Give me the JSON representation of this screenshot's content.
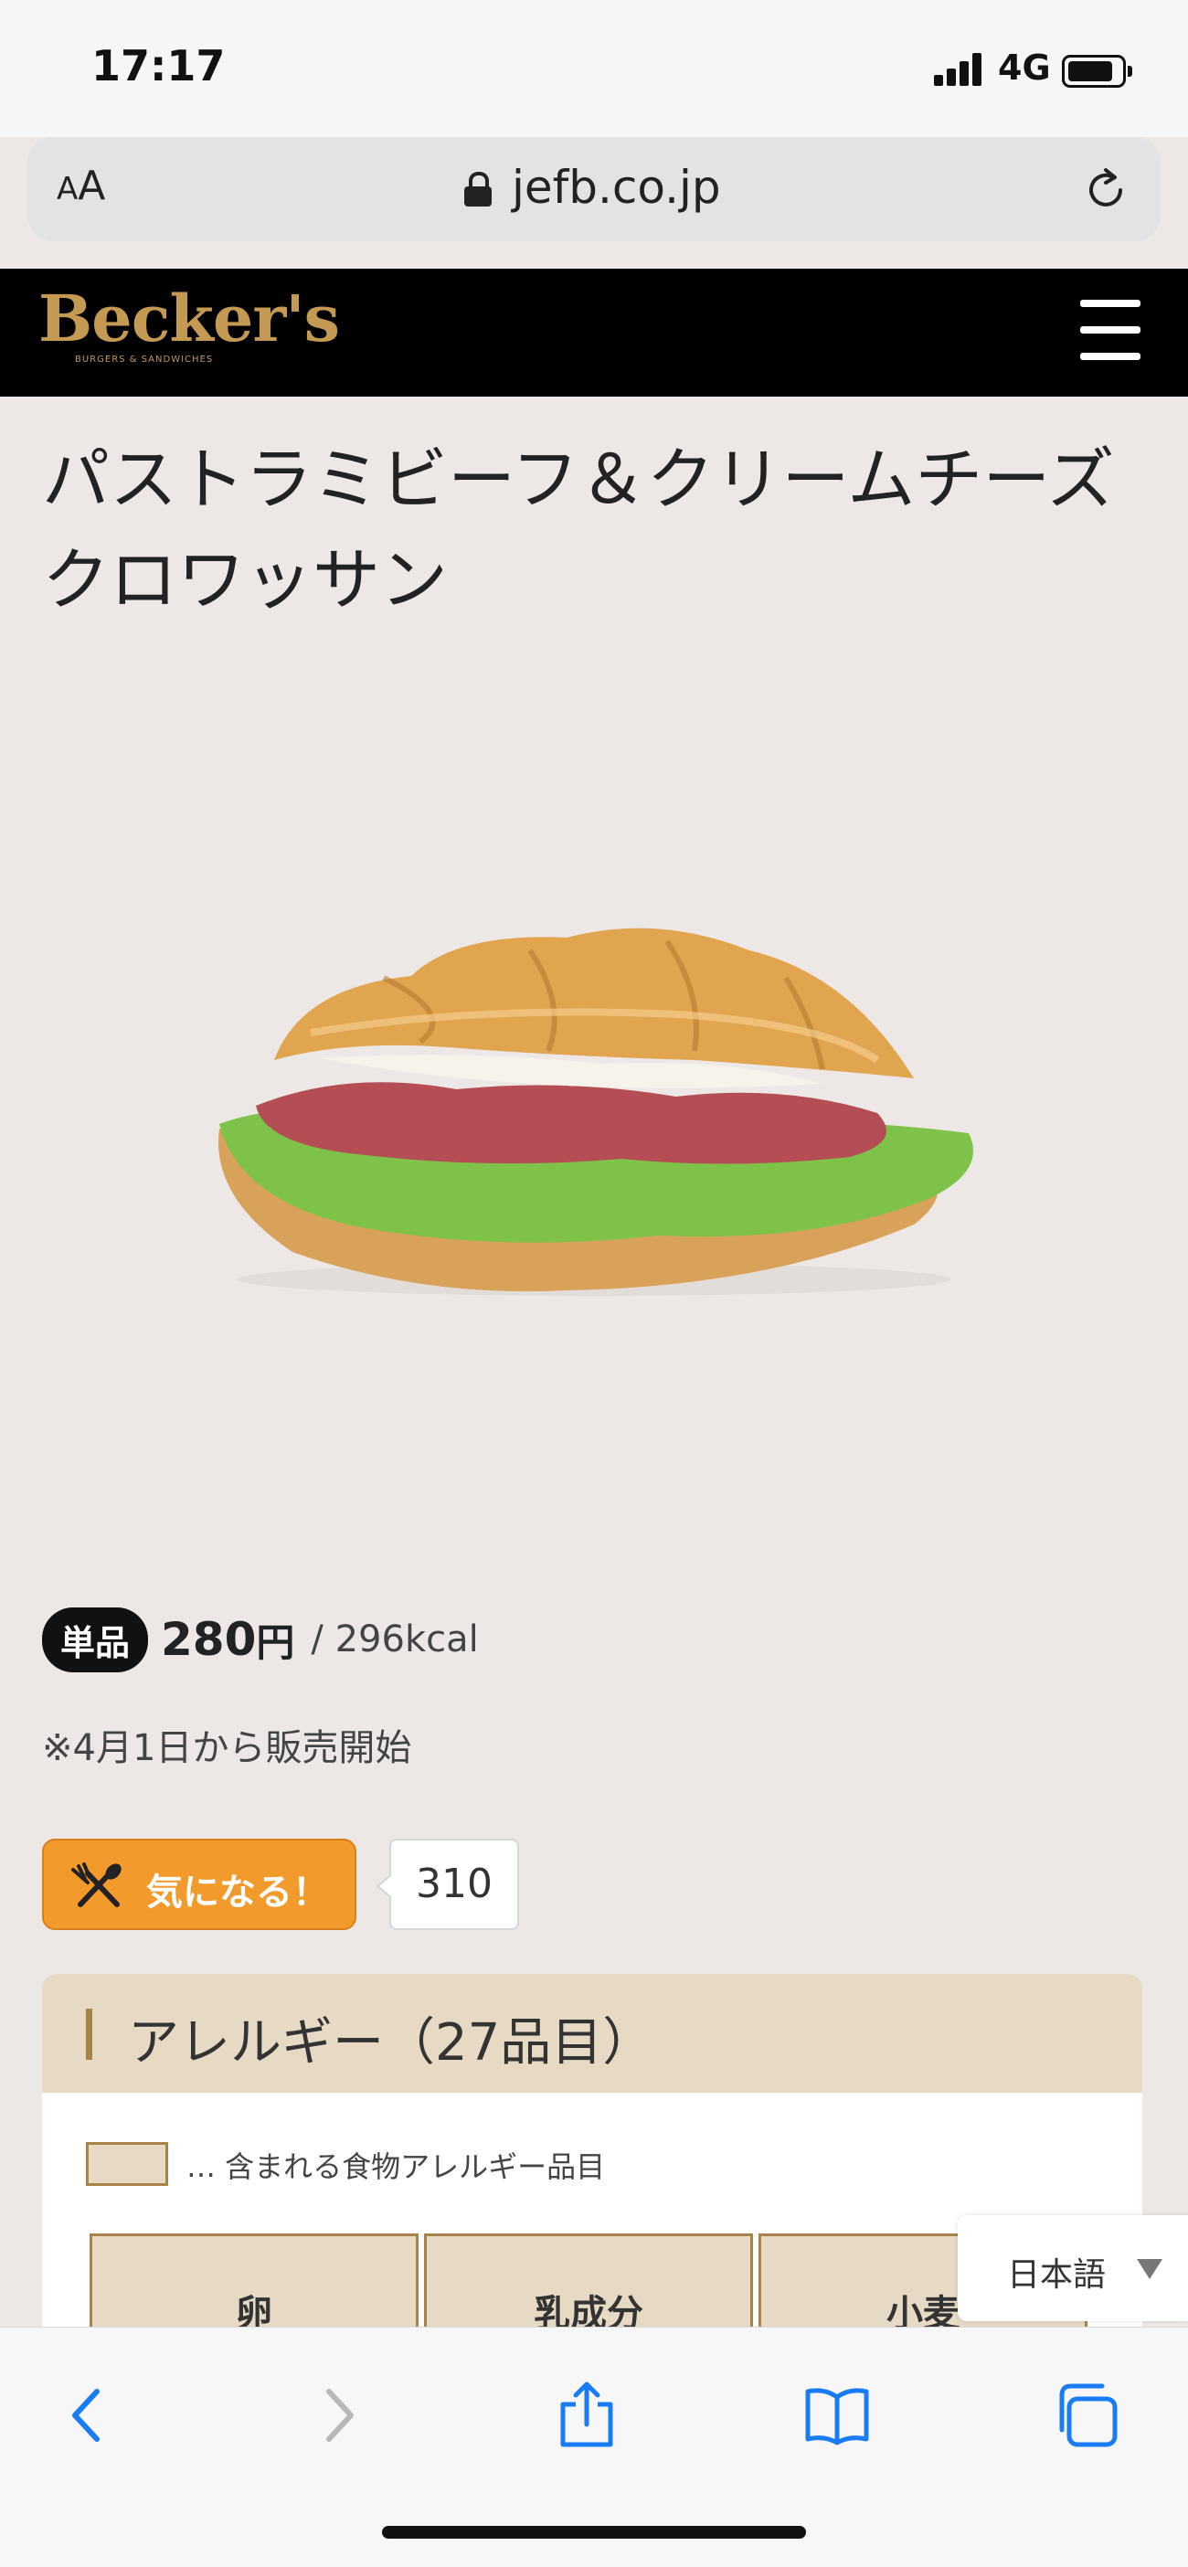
{
  "status_bar": {
    "time": "17:17",
    "network": "4G",
    "battery_level": 0.85
  },
  "browser": {
    "text_size_label_small": "A",
    "text_size_label_large": "A",
    "url": "jefb.co.jp"
  },
  "site": {
    "logo_text": "Becker's",
    "logo_tagline": "BURGERS & SANDWICHES"
  },
  "product": {
    "title": "パストラミビーフ＆クリームチーズクロワッサン",
    "badge": "単品",
    "price": "280",
    "currency": "円",
    "kcal": "/ 296kcal",
    "note": "※4月1日から販売開始"
  },
  "like": {
    "label": "気になる！",
    "count": "310"
  },
  "allergy": {
    "heading": "アレルギー（27品目）",
    "legend": "… 含まれる食物アレルギー品目",
    "items": [
      "卵",
      "乳成分",
      "小麦"
    ]
  },
  "language": {
    "selected": "日本語"
  },
  "icons": {
    "lock": "lock-icon",
    "reload": "reload-icon",
    "menu": "hamburger-menu-icon",
    "like": "fork-spoon-icon",
    "back": "back-icon",
    "forward": "forward-icon",
    "share": "share-icon",
    "bookmarks": "bookmarks-icon",
    "tabs": "tabs-icon"
  },
  "colors": {
    "accent_blue": "#1a7cf5",
    "like_orange": "#f29b2c",
    "logo_gold": "#c49a52",
    "allergy_tint": "#e6dac4"
  }
}
